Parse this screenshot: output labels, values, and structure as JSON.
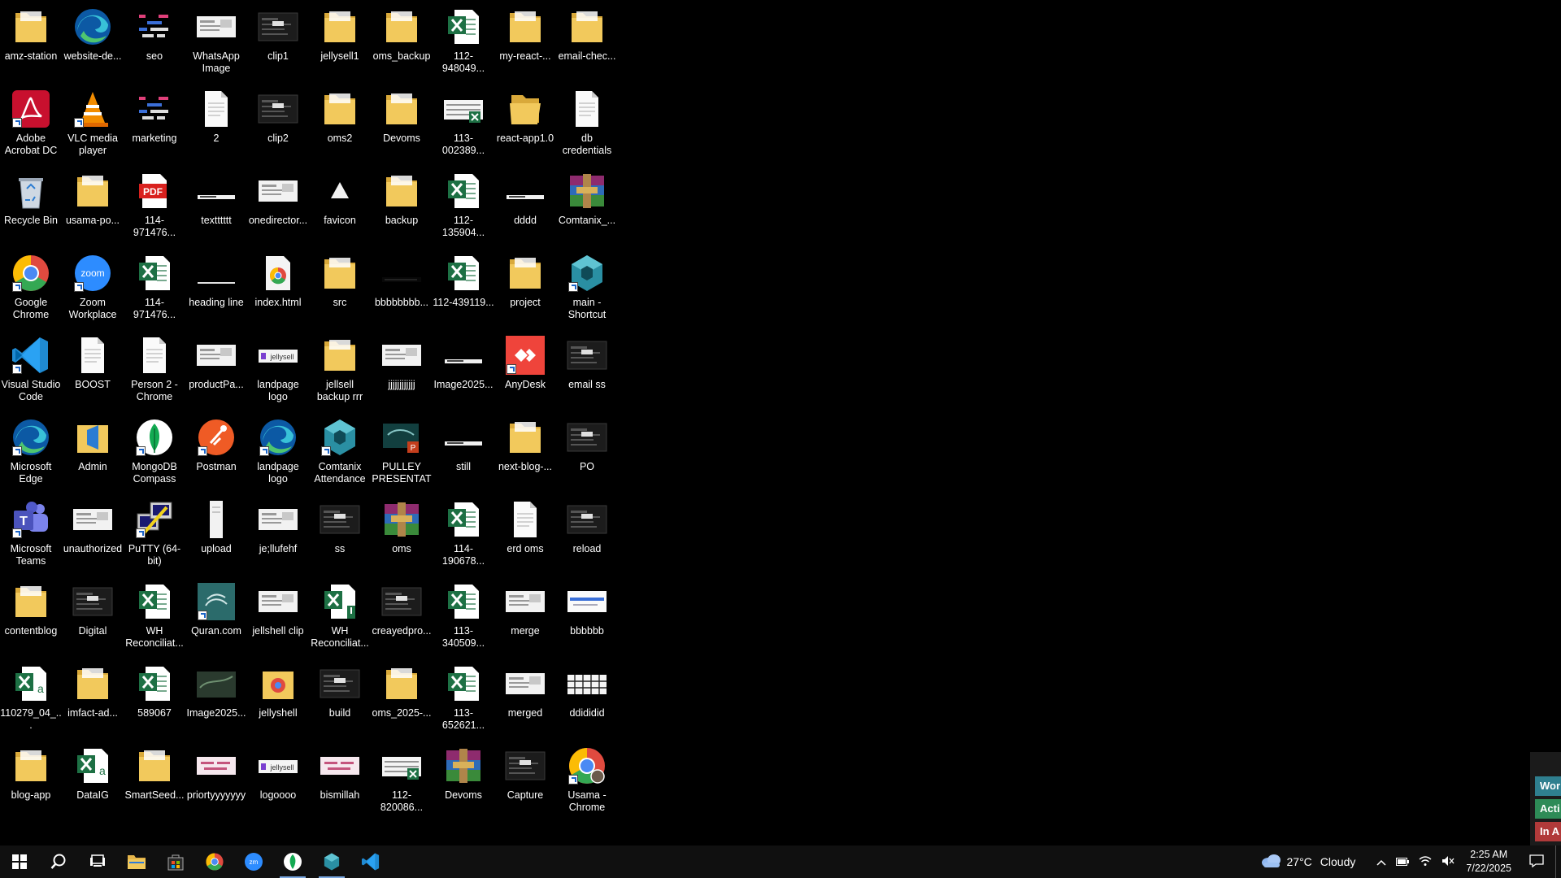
{
  "desktop": {
    "columns": [
      [
        {
          "label": "amz-station",
          "icon": "folder",
          "shortcut": false
        },
        {
          "label": "Adobe Acrobat DC",
          "icon": "acrobat",
          "shortcut": true
        },
        {
          "label": "Recycle Bin",
          "icon": "recycle",
          "shortcut": false
        },
        {
          "label": "Google Chrome",
          "icon": "chrome",
          "shortcut": true
        },
        {
          "label": "Visual Studio Code",
          "icon": "vscode",
          "shortcut": true
        },
        {
          "label": "Microsoft Edge",
          "icon": "edge",
          "shortcut": true
        },
        {
          "label": "Microsoft Teams",
          "icon": "teams",
          "shortcut": true
        },
        {
          "label": "contentblog",
          "icon": "folder",
          "shortcut": false
        },
        {
          "label": "110279_04_...",
          "icon": "excel-a",
          "shortcut": false
        },
        {
          "label": "blog-app",
          "icon": "folder",
          "shortcut": false
        }
      ],
      [
        {
          "label": "website-de...",
          "icon": "edge",
          "shortcut": false
        },
        {
          "label": "VLC media player",
          "icon": "vlc",
          "shortcut": true
        },
        {
          "label": "usama-po...",
          "icon": "folder",
          "shortcut": false
        },
        {
          "label": "Zoom Workplace",
          "icon": "zoom",
          "shortcut": true
        },
        {
          "label": "BOOST",
          "icon": "doc",
          "shortcut": false
        },
        {
          "label": "Admin",
          "icon": "folder-vs",
          "shortcut": false
        },
        {
          "label": "unauthorized",
          "icon": "thumb-light",
          "shortcut": false
        },
        {
          "label": "Digital",
          "icon": "thumb-dark",
          "shortcut": false
        },
        {
          "label": "imfact-ad...",
          "icon": "folder",
          "shortcut": false
        },
        {
          "label": "DataIG",
          "icon": "excel-a",
          "shortcut": false
        }
      ],
      [
        {
          "label": "seo",
          "icon": "seo",
          "shortcut": false
        },
        {
          "label": "marketing",
          "icon": "seo",
          "shortcut": false
        },
        {
          "label": "114-971476...",
          "icon": "pdf",
          "shortcut": false
        },
        {
          "label": "114-971476...",
          "icon": "excel",
          "shortcut": false
        },
        {
          "label": "Person 2 - Chrome",
          "icon": "doc",
          "shortcut": false
        },
        {
          "label": "MongoDB Compass",
          "icon": "mongodb",
          "shortcut": true
        },
        {
          "label": "PuTTY (64-bit)",
          "icon": "putty",
          "shortcut": true
        },
        {
          "label": "WH Reconciliat...",
          "icon": "excel",
          "shortcut": false
        },
        {
          "label": "589067",
          "icon": "excel",
          "shortcut": false
        },
        {
          "label": "SmartSeed...",
          "icon": "folder",
          "shortcut": false
        }
      ],
      [
        {
          "label": "WhatsApp Image 2025...",
          "icon": "thumb-light",
          "shortcut": false
        },
        {
          "label": "2",
          "icon": "doc",
          "shortcut": false
        },
        {
          "label": "textttttt",
          "icon": "line",
          "shortcut": false
        },
        {
          "label": "heading line",
          "icon": "line-thin",
          "shortcut": false
        },
        {
          "label": "productPa...",
          "icon": "thumb-light",
          "shortcut": false
        },
        {
          "label": "Postman",
          "icon": "postman",
          "shortcut": true
        },
        {
          "label": "upload",
          "icon": "doc-narrow",
          "shortcut": false
        },
        {
          "label": "Quran.com",
          "icon": "quran",
          "shortcut": true
        },
        {
          "label": "Image2025...",
          "icon": "thumb-green",
          "shortcut": false
        },
        {
          "label": "priortyyyyyyy",
          "icon": "thumb-pink",
          "shortcut": false
        }
      ],
      [
        {
          "label": "clip1",
          "icon": "thumb-dark",
          "shortcut": false
        },
        {
          "label": "clip2",
          "icon": "thumb-dark",
          "shortcut": false
        },
        {
          "label": "onedirector...",
          "icon": "thumb-light",
          "shortcut": false
        },
        {
          "label": "index.html",
          "icon": "chrome-file",
          "shortcut": false
        },
        {
          "label": "landpage logo",
          "icon": "jellysell",
          "shortcut": false
        },
        {
          "label": "landpage logo",
          "icon": "edge",
          "shortcut": true
        },
        {
          "label": "je;llufehf",
          "icon": "thumb-light",
          "shortcut": false
        },
        {
          "label": "jellshell clip",
          "icon": "thumb-light",
          "shortcut": false
        },
        {
          "label": "jellyshell",
          "icon": "folder-chrome",
          "shortcut": false
        },
        {
          "label": "logoooo",
          "icon": "jellysell",
          "shortcut": false
        }
      ],
      [
        {
          "label": "jellysell1",
          "icon": "folder",
          "shortcut": false
        },
        {
          "label": "oms2",
          "icon": "folder",
          "shortcut": false
        },
        {
          "label": "favicon",
          "icon": "triangle",
          "shortcut": false
        },
        {
          "label": "src",
          "icon": "folder",
          "shortcut": false
        },
        {
          "label": "jellsell backup rrr",
          "icon": "folder",
          "shortcut": false
        },
        {
          "label": "Comtanix Attendance",
          "icon": "comtanix",
          "shortcut": true
        },
        {
          "label": "ss",
          "icon": "thumb-dark",
          "shortcut": false
        },
        {
          "label": "WH Reconciliat...",
          "icon": "excel-alert",
          "shortcut": false
        },
        {
          "label": "build",
          "icon": "thumb-dark",
          "shortcut": false
        },
        {
          "label": "bismillah",
          "icon": "thumb-pink",
          "shortcut": false
        }
      ],
      [
        {
          "label": "oms_backup",
          "icon": "folder",
          "shortcut": false
        },
        {
          "label": "Devoms",
          "icon": "folder",
          "shortcut": false
        },
        {
          "label": "backup",
          "icon": "folder",
          "shortcut": false
        },
        {
          "label": "bbbbbbbb...",
          "icon": "thumb-black",
          "shortcut": false
        },
        {
          "label": "jjjjjjjjjjjj",
          "icon": "thumb-light",
          "shortcut": false
        },
        {
          "label": "PULLEY PRESENTATI...",
          "icon": "ppt",
          "shortcut": false
        },
        {
          "label": "oms",
          "icon": "winrar",
          "shortcut": false
        },
        {
          "label": "creayedpro...",
          "icon": "thumb-dark",
          "shortcut": false
        },
        {
          "label": "oms_2025-...",
          "icon": "folder",
          "shortcut": false
        },
        {
          "label": "112-820086...",
          "icon": "thumb-excel",
          "shortcut": false
        }
      ],
      [
        {
          "label": "112-948049...",
          "icon": "excel",
          "shortcut": false
        },
        {
          "label": "113-002389...",
          "icon": "thumb-excel",
          "shortcut": false
        },
        {
          "label": "112-135904...",
          "icon": "excel",
          "shortcut": false
        },
        {
          "label": "112-439119...",
          "icon": "excel",
          "shortcut": false
        },
        {
          "label": "Image2025...",
          "icon": "line",
          "shortcut": false
        },
        {
          "label": "still",
          "icon": "line",
          "shortcut": false
        },
        {
          "label": "114-190678...",
          "icon": "excel",
          "shortcut": false
        },
        {
          "label": "113-340509...",
          "icon": "excel",
          "shortcut": false
        },
        {
          "label": "113-652621...",
          "icon": "excel",
          "shortcut": false
        },
        {
          "label": "Devoms",
          "icon": "winrar",
          "shortcut": false
        }
      ],
      [
        {
          "label": "my-react-...",
          "icon": "folder",
          "shortcut": false
        },
        {
          "label": "react-app1.0",
          "icon": "folder-open",
          "shortcut": false
        },
        {
          "label": "dddd",
          "icon": "line",
          "shortcut": false
        },
        {
          "label": "project",
          "icon": "folder",
          "shortcut": false
        },
        {
          "label": "AnyDesk",
          "icon": "anydesk",
          "shortcut": true
        },
        {
          "label": "next-blog-...",
          "icon": "folder",
          "shortcut": false
        },
        {
          "label": "erd oms",
          "icon": "doc",
          "shortcut": false
        },
        {
          "label": "merge",
          "icon": "thumb-light",
          "shortcut": false
        },
        {
          "label": "merged",
          "icon": "thumb-light",
          "shortcut": false
        },
        {
          "label": "Capture",
          "icon": "thumb-dark",
          "shortcut": false
        }
      ],
      [
        {
          "label": "email-chec...",
          "icon": "folder",
          "shortcut": false
        },
        {
          "label": "db credentials",
          "icon": "doc",
          "shortcut": false
        },
        {
          "label": "Comtanix_...",
          "icon": "winrar",
          "shortcut": false
        },
        {
          "label": "main - Shortcut",
          "icon": "comtanix",
          "shortcut": true
        },
        {
          "label": "email ss",
          "icon": "thumb-dark",
          "shortcut": false
        },
        {
          "label": "PO",
          "icon": "thumb-dark",
          "shortcut": false
        },
        {
          "label": "reload",
          "icon": "thumb-dark",
          "shortcut": false
        },
        {
          "label": "bbbbbb",
          "icon": "thumb-blue",
          "shortcut": false
        },
        {
          "label": "ddididid",
          "icon": "thumb-table",
          "shortcut": false
        },
        {
          "label": "Usama - Chrome",
          "icon": "chrome-user",
          "shortcut": true
        }
      ]
    ]
  },
  "side_strip": {
    "badges": [
      {
        "text": "Wor",
        "color": "#2f7f8f"
      },
      {
        "text": "Acti",
        "color": "#2e8b57"
      },
      {
        "text": "In A",
        "color": "#b03a3a"
      }
    ]
  },
  "taskbar": {
    "apps": [
      {
        "name": "start",
        "icon": "windows"
      },
      {
        "name": "search",
        "icon": "search"
      },
      {
        "name": "task-view",
        "icon": "taskview"
      },
      {
        "name": "file-explorer",
        "icon": "explorer"
      },
      {
        "name": "store",
        "icon": "store"
      },
      {
        "name": "chrome",
        "icon": "chrome"
      },
      {
        "name": "zoom",
        "icon": "zoom"
      },
      {
        "name": "mongodb",
        "icon": "mongodb",
        "active": true
      },
      {
        "name": "comtanix",
        "icon": "comtanix",
        "active": true
      },
      {
        "name": "vscode",
        "icon": "vscode"
      }
    ],
    "weather": {
      "temp": "27°C",
      "condition": "Cloudy"
    },
    "clock": {
      "time": "2:25 AM",
      "date": "7/22/2025"
    }
  },
  "colors": {
    "folder": "#f2c95c",
    "excel": "#1d7044",
    "taskbar": "#101010",
    "desktop": "#000000"
  }
}
